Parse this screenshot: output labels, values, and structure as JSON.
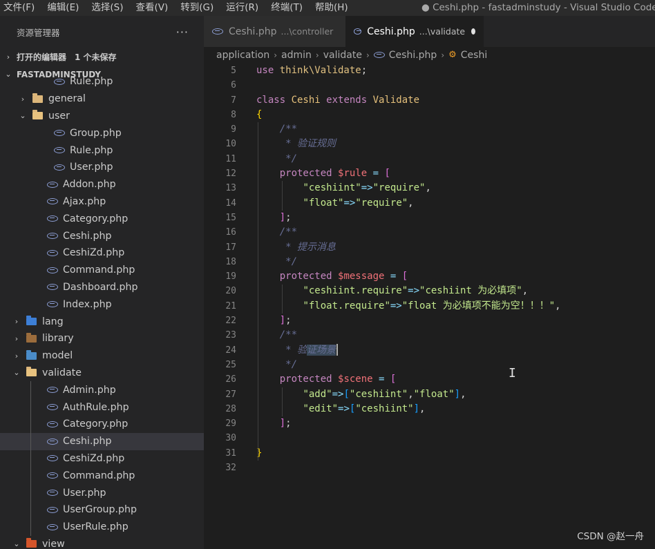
{
  "menu": [
    "文件(F)",
    "编辑(E)",
    "选择(S)",
    "查看(V)",
    "转到(G)",
    "运行(R)",
    "终端(T)",
    "帮助(H)"
  ],
  "window_title": "● Ceshi.php - fastadminstudy - Visual Studio Code",
  "sidebar": {
    "title": "资源管理器",
    "more": "···",
    "open_editors": "打开的编辑器",
    "unsaved": "1 个未保存",
    "project": "FASTADMINSTUDY"
  },
  "tree": [
    {
      "label": "Rule.php",
      "type": "file",
      "indent": 78
    },
    {
      "label": "general",
      "type": "folder",
      "indent": 49,
      "chev": "›"
    },
    {
      "label": "user",
      "type": "folder-open",
      "indent": 49,
      "chev": "⌄"
    },
    {
      "label": "Group.php",
      "type": "file",
      "indent": 78
    },
    {
      "label": "Rule.php",
      "type": "file",
      "indent": 78
    },
    {
      "label": "User.php",
      "type": "file",
      "indent": 78
    },
    {
      "label": "Addon.php",
      "type": "file",
      "indent": 68
    },
    {
      "label": "Ajax.php",
      "type": "file",
      "indent": 68
    },
    {
      "label": "Category.php",
      "type": "file",
      "indent": 68
    },
    {
      "label": "Ceshi.php",
      "type": "file",
      "indent": 68
    },
    {
      "label": "CeshiZd.php",
      "type": "file",
      "indent": 68
    },
    {
      "label": "Command.php",
      "type": "file",
      "indent": 68
    },
    {
      "label": "Dashboard.php",
      "type": "file",
      "indent": 68
    },
    {
      "label": "Index.php",
      "type": "file",
      "indent": 68
    },
    {
      "label": "lang",
      "type": "folder-lang",
      "indent": 40,
      "chev": "›"
    },
    {
      "label": "library",
      "type": "folder-library",
      "indent": 40,
      "chev": "›"
    },
    {
      "label": "model",
      "type": "folder-model",
      "indent": 40,
      "chev": "›"
    },
    {
      "label": "validate",
      "type": "folder-open",
      "indent": 40,
      "chev": "⌄"
    },
    {
      "label": "Admin.php",
      "type": "file",
      "indent": 68
    },
    {
      "label": "AuthRule.php",
      "type": "file",
      "indent": 68
    },
    {
      "label": "Category.php",
      "type": "file",
      "indent": 68
    },
    {
      "label": "Ceshi.php",
      "type": "file",
      "indent": 68,
      "selected": true
    },
    {
      "label": "CeshiZd.php",
      "type": "file",
      "indent": 68
    },
    {
      "label": "Command.php",
      "type": "file",
      "indent": 68
    },
    {
      "label": "User.php",
      "type": "file",
      "indent": 68
    },
    {
      "label": "UserGroup.php",
      "type": "file",
      "indent": 68
    },
    {
      "label": "UserRule.php",
      "type": "file",
      "indent": 68
    },
    {
      "label": "view",
      "type": "folder-view",
      "indent": 40,
      "chev": "⌄"
    }
  ],
  "tabs": [
    {
      "name": "Ceshi.php",
      "desc": "...\\controller",
      "active": false
    },
    {
      "name": "Ceshi.php",
      "desc": "...\\validate",
      "active": true
    }
  ],
  "breadcrumb": [
    "application",
    "admin",
    "validate",
    "Ceshi.php",
    "Ceshi"
  ],
  "code": [
    {
      "n": "5",
      "tokens": [
        [
          "kw",
          "use "
        ],
        [
          "ns",
          "think\\Validate"
        ],
        [
          "txt",
          ";"
        ]
      ]
    },
    {
      "n": "6",
      "tokens": []
    },
    {
      "n": "7",
      "tokens": [
        [
          "kw",
          "class "
        ],
        [
          "cls",
          "Ceshi "
        ],
        [
          "kw",
          "extends "
        ],
        [
          "cls",
          "Validate"
        ]
      ]
    },
    {
      "n": "8",
      "tokens": [
        [
          "brk",
          "{"
        ]
      ]
    },
    {
      "n": "9",
      "tokens": [
        [
          "txt",
          "    "
        ],
        [
          "cmt",
          "/**"
        ]
      ]
    },
    {
      "n": "10",
      "tokens": [
        [
          "txt",
          "     "
        ],
        [
          "cmt",
          "* 验证规则"
        ]
      ]
    },
    {
      "n": "11",
      "tokens": [
        [
          "txt",
          "     "
        ],
        [
          "cmt",
          "*/"
        ]
      ]
    },
    {
      "n": "12",
      "tokens": [
        [
          "txt",
          "    "
        ],
        [
          "kw",
          "protected "
        ],
        [
          "var",
          "$rule "
        ],
        [
          "op",
          "= "
        ],
        [
          "brk2",
          "["
        ]
      ]
    },
    {
      "n": "13",
      "tokens": [
        [
          "txt",
          "        "
        ],
        [
          "str",
          "\"ceshiint\""
        ],
        [
          "op",
          "=>"
        ],
        [
          "str",
          "\"require\""
        ],
        [
          "txt",
          ","
        ]
      ]
    },
    {
      "n": "14",
      "tokens": [
        [
          "txt",
          "        "
        ],
        [
          "str",
          "\"float\""
        ],
        [
          "op",
          "=>"
        ],
        [
          "str",
          "\"require\""
        ],
        [
          "txt",
          ","
        ]
      ]
    },
    {
      "n": "15",
      "tokens": [
        [
          "txt",
          "    "
        ],
        [
          "brk2",
          "]"
        ],
        [
          "txt",
          ";"
        ]
      ]
    },
    {
      "n": "16",
      "tokens": [
        [
          "txt",
          "    "
        ],
        [
          "cmt",
          "/**"
        ]
      ]
    },
    {
      "n": "17",
      "tokens": [
        [
          "txt",
          "     "
        ],
        [
          "cmt",
          "* 提示消息"
        ]
      ]
    },
    {
      "n": "18",
      "tokens": [
        [
          "txt",
          "     "
        ],
        [
          "cmt",
          "*/"
        ]
      ]
    },
    {
      "n": "19",
      "tokens": [
        [
          "txt",
          "    "
        ],
        [
          "kw",
          "protected "
        ],
        [
          "var",
          "$message "
        ],
        [
          "op",
          "= "
        ],
        [
          "brk2",
          "["
        ]
      ]
    },
    {
      "n": "20",
      "tokens": [
        [
          "txt",
          "        "
        ],
        [
          "str",
          "\"ceshiint.require\""
        ],
        [
          "op",
          "=>"
        ],
        [
          "str",
          "\"ceshiint 为必填项\""
        ],
        [
          "txt",
          ","
        ]
      ]
    },
    {
      "n": "21",
      "tokens": [
        [
          "txt",
          "        "
        ],
        [
          "str",
          "\"float.require\""
        ],
        [
          "op",
          "=>"
        ],
        [
          "str",
          "\"float 为必填项不能为空！！！\""
        ],
        [
          "txt",
          ","
        ]
      ]
    },
    {
      "n": "22",
      "tokens": [
        [
          "txt",
          "    "
        ],
        [
          "brk2",
          "]"
        ],
        [
          "txt",
          ";"
        ]
      ]
    },
    {
      "n": "23",
      "tokens": [
        [
          "txt",
          "    "
        ],
        [
          "cmt",
          "/**"
        ]
      ]
    },
    {
      "n": "24",
      "tokens": [
        [
          "txt",
          "     "
        ],
        [
          "cmt",
          "* 验"
        ],
        [
          "cmt hl",
          "证场景"
        ],
        [
          "cursor",
          ""
        ]
      ]
    },
    {
      "n": "25",
      "tokens": [
        [
          "txt",
          "     "
        ],
        [
          "cmt",
          "*/"
        ]
      ]
    },
    {
      "n": "26",
      "tokens": [
        [
          "txt",
          "    "
        ],
        [
          "kw",
          "protected "
        ],
        [
          "var",
          "$scene "
        ],
        [
          "op",
          "= "
        ],
        [
          "brk2",
          "["
        ]
      ]
    },
    {
      "n": "27",
      "tokens": [
        [
          "txt",
          "        "
        ],
        [
          "str",
          "\"add\""
        ],
        [
          "op",
          "=>"
        ],
        [
          "brk3",
          "["
        ],
        [
          "str",
          "\"ceshiint\""
        ],
        [
          "txt",
          ","
        ],
        [
          "str",
          "\"float\""
        ],
        [
          "brk3",
          "]"
        ],
        [
          "txt",
          ","
        ]
      ]
    },
    {
      "n": "28",
      "tokens": [
        [
          "txt",
          "        "
        ],
        [
          "str",
          "\"edit\""
        ],
        [
          "op",
          "=>"
        ],
        [
          "brk3",
          "["
        ],
        [
          "str",
          "\"ceshiint\""
        ],
        [
          "brk3",
          "]"
        ],
        [
          "txt",
          ","
        ]
      ]
    },
    {
      "n": "29",
      "tokens": [
        [
          "txt",
          "    "
        ],
        [
          "brk2",
          "]"
        ],
        [
          "txt",
          ";"
        ]
      ]
    },
    {
      "n": "30",
      "tokens": []
    },
    {
      "n": "31",
      "tokens": [
        [
          "brk",
          "}"
        ]
      ]
    },
    {
      "n": "32",
      "tokens": []
    }
  ],
  "watermark": "CSDN @赵一舟"
}
